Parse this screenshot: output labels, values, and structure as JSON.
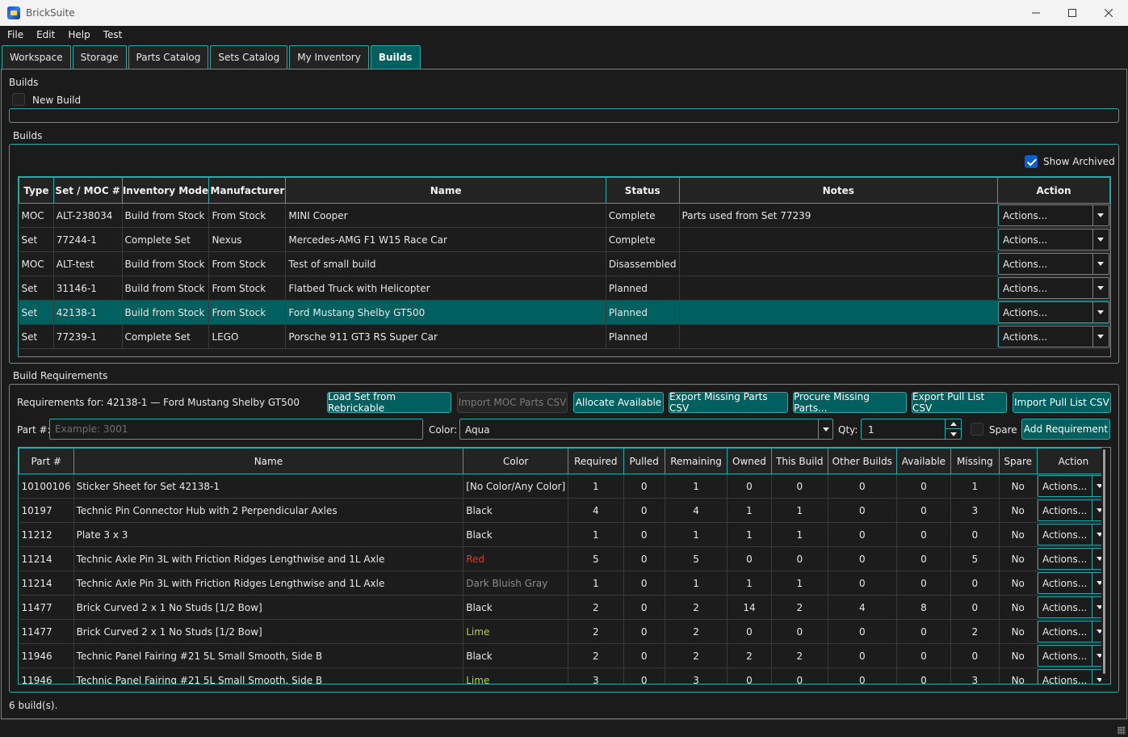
{
  "window": {
    "title": "BrickSuite",
    "minimize_icon": "minimize-icon",
    "maximize_icon": "maximize-icon",
    "close_icon": "close-icon"
  },
  "menu": [
    "File",
    "Edit",
    "Help",
    "Test"
  ],
  "tabs": [
    {
      "label": "Workspace",
      "active": false
    },
    {
      "label": "Storage",
      "active": false
    },
    {
      "label": "Parts Catalog",
      "active": false
    },
    {
      "label": "Sets Catalog",
      "active": false
    },
    {
      "label": "My Inventory",
      "active": false
    },
    {
      "label": "Builds",
      "active": true
    }
  ],
  "header": {
    "section_title": "Builds",
    "new_build_label": "New Build"
  },
  "builds": {
    "group_title": "Builds",
    "show_archived_label": "Show Archived",
    "show_archived_checked": true,
    "columns": [
      "Type",
      "Set / MOC #",
      "Inventory Mode",
      "Manufacturer",
      "Name",
      "Status",
      "Notes",
      "Action"
    ],
    "rows": [
      {
        "type": "MOC",
        "number": "ALT-238034",
        "mode": "Build from Stock",
        "manufacturer": "From Stock",
        "name": "MINI Cooper",
        "status": "Complete",
        "notes": "Parts used from Set 77239",
        "action": "Actions...",
        "selected": false
      },
      {
        "type": "Set",
        "number": "77244-1",
        "mode": "Complete Set",
        "manufacturer": "Nexus",
        "name": "Mercedes-AMG F1 W15 Race Car",
        "status": "Complete",
        "notes": "",
        "action": "Actions...",
        "selected": false
      },
      {
        "type": "MOC",
        "number": "ALT-test",
        "mode": "Build from Stock",
        "manufacturer": "From Stock",
        "name": "Test of small build",
        "status": "Disassembled",
        "notes": "",
        "action": "Actions...",
        "selected": false
      },
      {
        "type": "Set",
        "number": "31146-1",
        "mode": "Build from Stock",
        "manufacturer": "From Stock",
        "name": "Flatbed Truck with Helicopter",
        "status": "Planned",
        "notes": "",
        "action": "Actions...",
        "selected": false
      },
      {
        "type": "Set",
        "number": "42138-1",
        "mode": "Build from Stock",
        "manufacturer": "From Stock",
        "name": "Ford Mustang Shelby GT500",
        "status": "Planned",
        "notes": "",
        "action": "Actions...",
        "selected": true
      },
      {
        "type": "Set",
        "number": "77239-1",
        "mode": "Complete Set",
        "manufacturer": "LEGO",
        "name": "Porsche 911 GT3 RS Super Car",
        "status": "Planned",
        "notes": "",
        "action": "Actions...",
        "selected": false
      }
    ]
  },
  "requirements": {
    "group_title": "Build Requirements",
    "requirements_for": "Requirements for: 42138-1 — Ford Mustang Shelby GT500",
    "buttons": {
      "load_set": "Load Set from Rebrickable",
      "import_moc": "Import MOC Parts CSV",
      "allocate": "Allocate Available",
      "export_missing": "Export Missing Parts CSV",
      "procure_missing": "Procure Missing Parts...",
      "export_pull": "Export Pull List CSV",
      "import_pull": "Import Pull List CSV",
      "add_requirement": "Add Requirement"
    },
    "part_label": "Part #:",
    "part_placeholder": "Example: 3001",
    "color_label": "Color:",
    "color_value": "Aqua",
    "qty_label": "Qty:",
    "qty_value": "1",
    "spare_label": "Spare",
    "columns": [
      "Part #",
      "Name",
      "Color",
      "Required",
      "Pulled",
      "Remaining",
      "Owned",
      "This Build",
      "Other Builds",
      "Available",
      "Missing",
      "Spare",
      "Action"
    ],
    "rows": [
      {
        "part": "10100106",
        "name": "Sticker Sheet for Set 42138-1",
        "color": "[No Color/Any Color]",
        "color_hex": "#e8e8e8",
        "required": "1",
        "pulled": "0",
        "remaining": "1",
        "owned": "0",
        "this_build": "0",
        "other_builds": "0",
        "available": "0",
        "missing": "1",
        "spare": "No",
        "action": "Actions..."
      },
      {
        "part": "10197",
        "name": "Technic Pin Connector Hub with 2 Perpendicular Axles",
        "color": "Black",
        "color_hex": "#e8e8e8",
        "required": "4",
        "pulled": "0",
        "remaining": "4",
        "owned": "1",
        "this_build": "1",
        "other_builds": "0",
        "available": "0",
        "missing": "3",
        "spare": "No",
        "action": "Actions..."
      },
      {
        "part": "11212",
        "name": "Plate 3 x 3",
        "color": "Black",
        "color_hex": "#e8e8e8",
        "required": "1",
        "pulled": "0",
        "remaining": "1",
        "owned": "1",
        "this_build": "1",
        "other_builds": "0",
        "available": "0",
        "missing": "0",
        "spare": "No",
        "action": "Actions..."
      },
      {
        "part": "11214",
        "name": "Technic Axle Pin 3L with Friction Ridges Lengthwise and 1L Axle",
        "color": "Red",
        "color_hex": "#e0372c",
        "required": "5",
        "pulled": "0",
        "remaining": "5",
        "owned": "0",
        "this_build": "0",
        "other_builds": "0",
        "available": "0",
        "missing": "5",
        "spare": "No",
        "action": "Actions..."
      },
      {
        "part": "11214",
        "name": "Technic Axle Pin 3L with Friction Ridges Lengthwise and 1L Axle",
        "color": "Dark Bluish Gray",
        "color_hex": "#8c8c8c",
        "required": "1",
        "pulled": "0",
        "remaining": "1",
        "owned": "1",
        "this_build": "1",
        "other_builds": "0",
        "available": "0",
        "missing": "0",
        "spare": "No",
        "action": "Actions..."
      },
      {
        "part": "11477",
        "name": "Brick Curved 2 x 1 No Studs [1/2 Bow]",
        "color": "Black",
        "color_hex": "#e8e8e8",
        "required": "2",
        "pulled": "0",
        "remaining": "2",
        "owned": "14",
        "this_build": "2",
        "other_builds": "4",
        "available": "8",
        "missing": "0",
        "spare": "No",
        "action": "Actions..."
      },
      {
        "part": "11477",
        "name": "Brick Curved 2 x 1 No Studs [1/2 Bow]",
        "color": "Lime",
        "color_hex": "#b5d91d",
        "required": "2",
        "pulled": "0",
        "remaining": "2",
        "owned": "0",
        "this_build": "0",
        "other_builds": "0",
        "available": "0",
        "missing": "2",
        "spare": "No",
        "action": "Actions..."
      },
      {
        "part": "11946",
        "name": "Technic Panel Fairing #21 5L Small Smooth, Side B",
        "color": "Black",
        "color_hex": "#e8e8e8",
        "required": "2",
        "pulled": "0",
        "remaining": "2",
        "owned": "2",
        "this_build": "2",
        "other_builds": "0",
        "available": "0",
        "missing": "0",
        "spare": "No",
        "action": "Actions..."
      },
      {
        "part": "11946",
        "name": "Technic Panel Fairing #21 5L Small Smooth, Side B",
        "color": "Lime",
        "color_hex": "#b5d91d",
        "required": "3",
        "pulled": "0",
        "remaining": "3",
        "owned": "0",
        "this_build": "0",
        "other_builds": "0",
        "available": "0",
        "missing": "3",
        "spare": "No",
        "action": "Actions..."
      }
    ]
  },
  "status": {
    "text": "6 build(s)."
  },
  "colors": {
    "accent": "#2aa8a8",
    "selected_row": "#005f5f",
    "background": "#1b1b1b"
  }
}
